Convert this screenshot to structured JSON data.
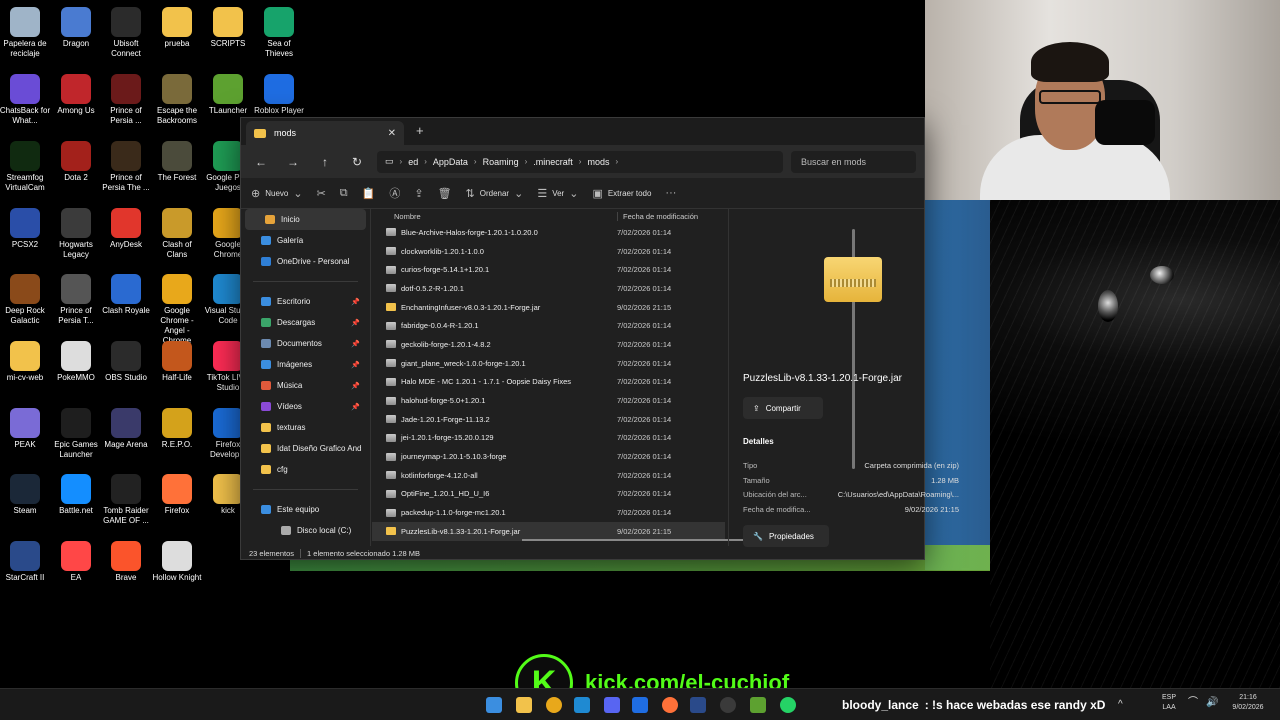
{
  "desktop_icons": [
    {
      "label": "Papelera de reciclaje",
      "color": "#9fb4c8"
    },
    {
      "label": "Dragon",
      "color": "#4a7bd1"
    },
    {
      "label": "Ubisoft Connect",
      "color": "#2b2b2b"
    },
    {
      "label": "prueba",
      "color": "#f2c24b"
    },
    {
      "label": "SCRIPTS",
      "color": "#f2c24b"
    },
    {
      "label": "Sea of Thieves",
      "color": "#17a36b"
    },
    {
      "label": "ChatsBack for What...",
      "color": "#6a4cd6"
    },
    {
      "label": "Among Us",
      "color": "#c0262b"
    },
    {
      "label": "Prince of Persia ...",
      "color": "#6b1a1a"
    },
    {
      "label": "Escape the Backrooms",
      "color": "#7a6a3a"
    },
    {
      "label": "TLauncher",
      "color": "#5da130"
    },
    {
      "label": "Roblox Player",
      "color": "#1f6de2"
    },
    {
      "label": "Streamfog VirtualCam",
      "color": "#102a10"
    },
    {
      "label": "Dota 2",
      "color": "#a3211b"
    },
    {
      "label": "Prince of Persia The ...",
      "color": "#3a2a1a"
    },
    {
      "label": "The Forest",
      "color": "#4b4b3b"
    },
    {
      "label": "Google Play Juegos",
      "color": "#1f9d55"
    },
    {
      "label": "Microsoft Edge",
      "color": "#1b8fd6"
    },
    {
      "label": "PCSX2",
      "color": "#2a4ea8"
    },
    {
      "label": "Hogwarts Legacy",
      "color": "#3b3b3b"
    },
    {
      "label": "AnyDesk",
      "color": "#e1362c"
    },
    {
      "label": "Clash of Clans",
      "color": "#c99a2a"
    },
    {
      "label": "Google Chrome",
      "color": "#e8a81b"
    },
    {
      "label": "Discord",
      "color": "#5865f2"
    },
    {
      "label": "Deep Rock Galactic",
      "color": "#8a4a1a"
    },
    {
      "label": "Prince of Persia T...",
      "color": "#555555"
    },
    {
      "label": "Clash Royale",
      "color": "#2a6ad1"
    },
    {
      "label": "Google Chrome - Angel - Chrome",
      "color": "#e8a81b"
    },
    {
      "label": "Visual Studio Code",
      "color": "#1f8ad2"
    },
    {
      "label": "NVIDIA App",
      "color": "#76b900"
    },
    {
      "label": "mi-cv-web",
      "color": "#f2c24b"
    },
    {
      "label": "PokeMMO",
      "color": "#dddddd"
    },
    {
      "label": "OBS Studio",
      "color": "#2b2b2b"
    },
    {
      "label": "Half-Life",
      "color": "#c3571c"
    },
    {
      "label": "TikTok LIVE Studio",
      "color": "#fe2c55"
    },
    {
      "label": "ROSE IBM",
      "color": "#b81d24"
    },
    {
      "label": "PEAK",
      "color": "#7a6bd6"
    },
    {
      "label": "Epic Games Launcher",
      "color": "#1e1e1e"
    },
    {
      "label": "Mage Arena",
      "color": "#3a3a6a"
    },
    {
      "label": "R.E.P.O.",
      "color": "#d4a21b"
    },
    {
      "label": "Firefox Develop...",
      "color": "#1a6bd6"
    },
    {
      "label": "Outlast",
      "color": "#1b2a1b"
    },
    {
      "label": "Steam",
      "color": "#1b2838"
    },
    {
      "label": "Battle.net",
      "color": "#148eff"
    },
    {
      "label": "Tomb Raider GAME OF ...",
      "color": "#222222"
    },
    {
      "label": "Firefox",
      "color": "#ff7139"
    },
    {
      "label": "kick",
      "color": "#f2c24b"
    },
    {
      "label": "Left 4 Dead 2",
      "color": "#8a1a1a"
    },
    {
      "label": "StarCraft II",
      "color": "#2a4a8a"
    },
    {
      "label": "EA",
      "color": "#ff4747"
    },
    {
      "label": "Brave",
      "color": "#fb542b"
    },
    {
      "label": "Hollow Knight",
      "color": "#dddddd"
    }
  ],
  "explorer": {
    "tab_title": "mods",
    "breadcrumbs": [
      "ed",
      "AppData",
      "Roaming",
      ".minecraft",
      "mods"
    ],
    "search_placeholder": "Buscar en mods",
    "commands": {
      "nuevo": "Nuevo",
      "ordenar": "Ordenar",
      "ver": "Ver",
      "extraer": "Extraer todo"
    },
    "nav": {
      "top": [
        {
          "label": "Inicio",
          "color": "#e6a33a",
          "selected": true
        },
        {
          "label": "Galería",
          "color": "#3b8ee0"
        },
        {
          "label": "OneDrive - Personal",
          "color": "#2f7fd6"
        }
      ],
      "quick": [
        {
          "label": "Escritorio",
          "color": "#3b8ee0",
          "pinned": true
        },
        {
          "label": "Descargas",
          "color": "#3ba56a",
          "pinned": true
        },
        {
          "label": "Documentos",
          "color": "#6c8ab0",
          "pinned": true
        },
        {
          "label": "Imágenes",
          "color": "#3b8ee0",
          "pinned": true
        },
        {
          "label": "Música",
          "color": "#e05a3b",
          "pinned": true
        },
        {
          "label": "Vídeos",
          "color": "#8a4ad6",
          "pinned": true
        },
        {
          "label": "texturas",
          "color": "#f2c24b"
        },
        {
          "label": "Idat Diseño Grafico And",
          "color": "#f2c24b"
        },
        {
          "label": "cfg",
          "color": "#f2c24b"
        }
      ],
      "bottom": [
        {
          "label": "Este equipo",
          "color": "#3b8ee0"
        },
        {
          "label": "Disco local (C:)",
          "color": "#aaaaaa"
        }
      ]
    },
    "columns": {
      "name": "Nombre",
      "date": "Fecha de modificación"
    },
    "files": [
      {
        "name": "Blue-Archive-Halos-forge-1.20.1-1.0.20.0",
        "date": "7/02/2026 01:14",
        "type": "zip"
      },
      {
        "name": "clockworklib-1.20.1-1.0.0",
        "date": "7/02/2026 01:14",
        "type": "zip"
      },
      {
        "name": "curios-forge-5.14.1+1.20.1",
        "date": "7/02/2026 01:14",
        "type": "zip"
      },
      {
        "name": "dotf-0.5.2-R-1.20.1",
        "date": "7/02/2026 01:14",
        "type": "zip"
      },
      {
        "name": "EnchantingInfuser-v8.0.3-1.20.1-Forge.jar",
        "date": "9/02/2026 21:15",
        "type": "folder"
      },
      {
        "name": "fabridge-0.0.4-R-1.20.1",
        "date": "7/02/2026 01:14",
        "type": "zip"
      },
      {
        "name": "geckolib-forge-1.20.1-4.8.2",
        "date": "7/02/2026 01:14",
        "type": "zip"
      },
      {
        "name": "giant_plane_wreck-1.0.0-forge-1.20.1",
        "date": "7/02/2026 01:14",
        "type": "zip"
      },
      {
        "name": "Halo  MDE - MC 1.20.1 - 1.7.1 - Oopsie Daisy Fixes",
        "date": "7/02/2026 01:14",
        "type": "zip"
      },
      {
        "name": "halohud-forge-5.0+1.20.1",
        "date": "7/02/2026 01:14",
        "type": "zip"
      },
      {
        "name": "Jade-1.20.1-Forge-11.13.2",
        "date": "7/02/2026 01:14",
        "type": "zip"
      },
      {
        "name": "jei-1.20.1-forge-15.20.0.129",
        "date": "7/02/2026 01:14",
        "type": "zip"
      },
      {
        "name": "journeymap-1.20.1-5.10.3-forge",
        "date": "7/02/2026 01:14",
        "type": "zip"
      },
      {
        "name": "kotlinforforge-4.12.0-all",
        "date": "7/02/2026 01:14",
        "type": "zip"
      },
      {
        "name": "OptiFine_1.20.1_HD_U_I6",
        "date": "7/02/2026 01:14",
        "type": "zip"
      },
      {
        "name": "packedup-1.1.0-forge-mc1.20.1",
        "date": "7/02/2026 01:14",
        "type": "zip"
      },
      {
        "name": "PuzzlesLib-v8.1.33-1.20.1-Forge.jar",
        "date": "9/02/2026 21:15",
        "type": "folder",
        "selected": true
      }
    ],
    "preview": {
      "filename": "PuzzlesLib-v8.1.33-1.20.1-Forge.jar",
      "share": "Compartir",
      "details_title": "Detalles",
      "details": [
        {
          "k": "Tipo",
          "v": "Carpeta comprimida (en zip)"
        },
        {
          "k": "Tamaño",
          "v": "1.28 MB"
        },
        {
          "k": "Ubicación del arc...",
          "v": "C:\\Usuarios\\ed\\AppData\\Roaming\\..."
        },
        {
          "k": "Fecha de modifica...",
          "v": "9/02/2026 21:15"
        }
      ],
      "properties": "Propiedades"
    },
    "status": {
      "count": "23 elementos",
      "selected": "1 elemento seleccionado  1.28 MB"
    }
  },
  "overlay": {
    "kick_logo": "K",
    "kick_url": "kick.com/el-cuchiof"
  },
  "chat": {
    "user": "bloody_lance",
    "message": ": !s hace webadas ese randy xD"
  },
  "tray": {
    "lang": "ESP",
    "layout": "LAA",
    "time": "21:16",
    "date": "9/02/2026"
  }
}
